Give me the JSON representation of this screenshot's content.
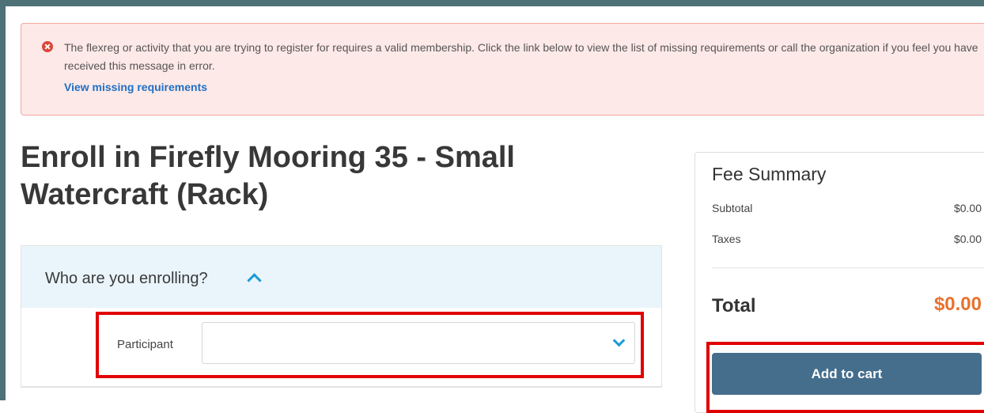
{
  "alert": {
    "icon": "error-circle-icon",
    "message": "The flexreg or activity that you are trying to register for requires a valid membership. Click the link below to view the list of missing requirements or call the organization if you feel you have received this message in error.",
    "link_label": "View missing requirements",
    "colors": {
      "background": "#fde9e7",
      "border": "#f1a8a1",
      "icon": "#d9473a",
      "link": "#1f6fc5"
    }
  },
  "page": {
    "title": "Enroll in Firefly Mooring 35 - Small Watercraft (Rack)"
  },
  "enrollment": {
    "section_title": "Who are you enrolling?",
    "section_icon": "chevron-up-icon",
    "participant_label": "Participant",
    "participant_value": "",
    "participant_icon": "chevron-down-icon"
  },
  "fee_summary": {
    "title": "Fee Summary",
    "rows": [
      {
        "label": "Subtotal",
        "value": "$0.00"
      },
      {
        "label": "Taxes",
        "value": "$0.00"
      }
    ],
    "total_label": "Total",
    "total_value": "$0.00",
    "add_to_cart_label": "Add to cart",
    "colors": {
      "total": "#e8712d",
      "button": "#456e8d"
    }
  },
  "highlight_color": "#e10000"
}
